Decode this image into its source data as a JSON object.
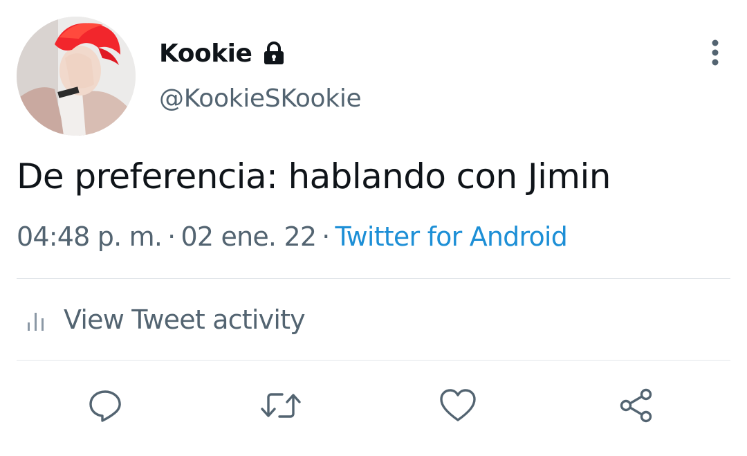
{
  "author": {
    "display_name": "Kookie",
    "handle": "@KookieSKookie",
    "protected_icon": "lock-icon"
  },
  "tweet": {
    "text": "De preferencia: hablando con Jimin",
    "time": "04:48 p. m.",
    "separator": "·",
    "date": "02 ene. 22",
    "source": "Twitter for Android"
  },
  "activity": {
    "label": "View Tweet activity",
    "icon": "bar-chart-icon"
  },
  "actions": {
    "reply_icon": "reply-icon",
    "retweet_icon": "retweet-icon",
    "like_icon": "heart-icon",
    "share_icon": "share-icon"
  },
  "colors": {
    "text_primary": "#0f1419",
    "text_secondary": "#536471",
    "link": "#1d8fd6",
    "divider": "#e1e6ea"
  }
}
